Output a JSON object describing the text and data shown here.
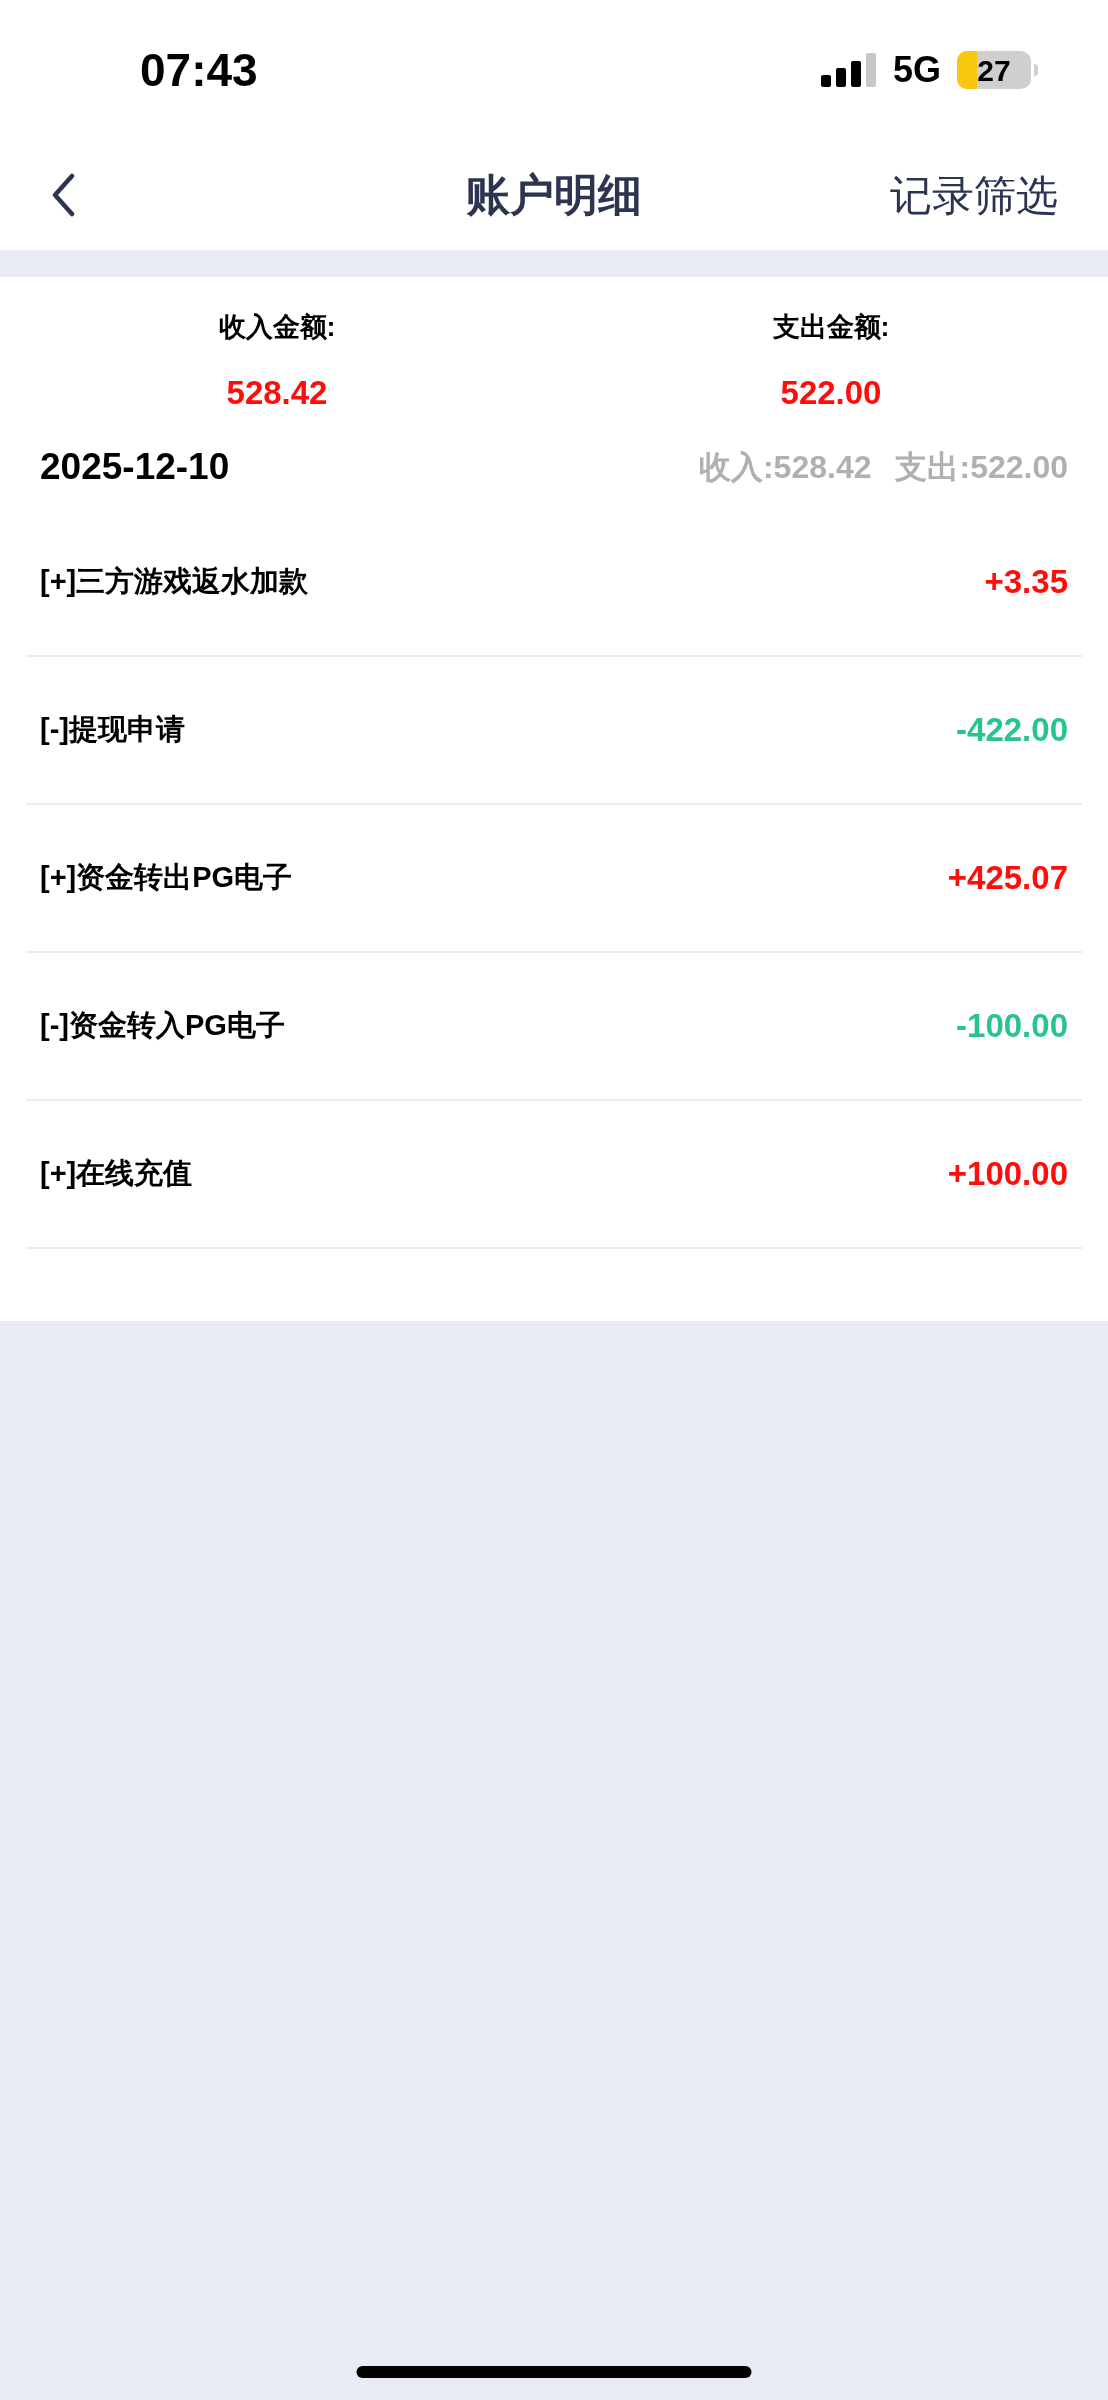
{
  "status_bar": {
    "time": "07:43",
    "network": "5G",
    "battery": "27"
  },
  "header": {
    "title": "账户明细",
    "action": "记录筛选"
  },
  "summary": [
    {
      "label": "收入金额:",
      "value": "528.42"
    },
    {
      "label": "支出金额:",
      "value": "522.00"
    }
  ],
  "day": {
    "date": "2025-12-10",
    "income": "收入:528.42",
    "expense": "支出:522.00"
  },
  "records": [
    {
      "kind": "income",
      "title": "[+]三方游戏返水加款",
      "amount": "+3.35"
    },
    {
      "kind": "expense",
      "title": "[-]提现申请",
      "amount": "-422.00"
    },
    {
      "kind": "income",
      "title": "[+]资金转出PG电子",
      "amount": "+425.07"
    },
    {
      "kind": "expense",
      "title": "[-]资金转入PG电子",
      "amount": "-100.00"
    },
    {
      "kind": "income",
      "title": "[+]在线充值",
      "amount": "+100.00"
    }
  ]
}
